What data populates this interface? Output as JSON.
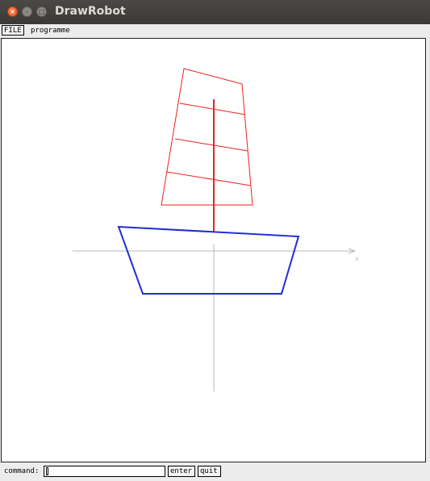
{
  "window": {
    "title": "DrawRobot",
    "close_glyph": "×",
    "minimize_glyph": "–",
    "maximize_glyph": "□"
  },
  "menu": {
    "file_label": "FILE",
    "programme_label": "programme"
  },
  "canvas": {
    "axis_x_label": "x",
    "colors": {
      "sail": "#e8231e",
      "mast": "#e8231e",
      "hull": "#1f2ed6",
      "axes": "#b9b9b9"
    }
  },
  "command": {
    "label": "command:",
    "input_value": "",
    "enter_label": "enter",
    "quit_label": "quit"
  }
}
